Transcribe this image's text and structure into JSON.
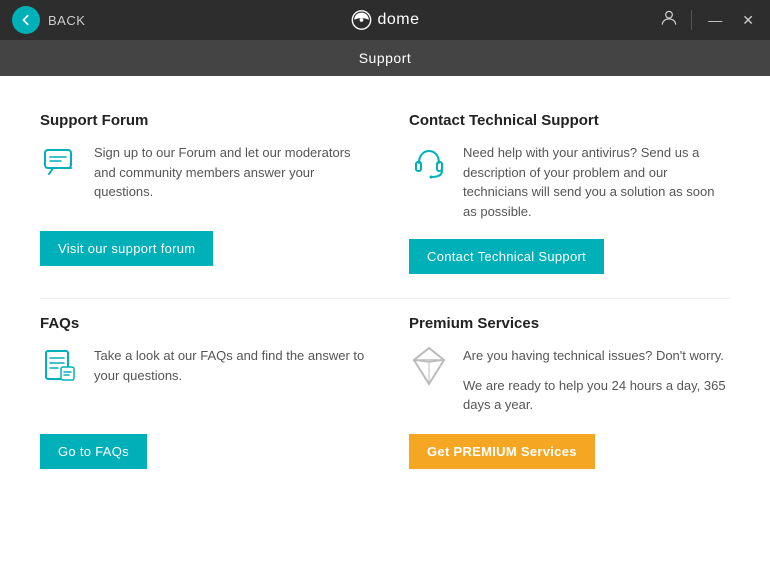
{
  "titlebar": {
    "back_label": "BACK",
    "logo_name": "dome",
    "minimize_label": "—",
    "close_label": "✕"
  },
  "subheader": {
    "title": "Support"
  },
  "sections": {
    "support_forum": {
      "title": "Support Forum",
      "description": "Sign up to our Forum and let our moderators and community members answer your questions.",
      "button_label": "Visit our support forum"
    },
    "contact_support": {
      "title": "Contact Technical Support",
      "description": "Need help with your antivirus? Send us a description of your problem and our technicians will send you a solution as soon as possible.",
      "button_label": "Contact Technical Support"
    },
    "faqs": {
      "title": "FAQs",
      "description": "Take a look at our FAQs and find the answer to your questions.",
      "button_label": "Go to FAQs"
    },
    "premium": {
      "title": "Premium Services",
      "description_1": "Are you having technical issues? Don't worry.",
      "description_2": "We are ready to help you 24 hours a day, 365 days a year.",
      "button_label": "Get PREMIUM Services"
    }
  }
}
